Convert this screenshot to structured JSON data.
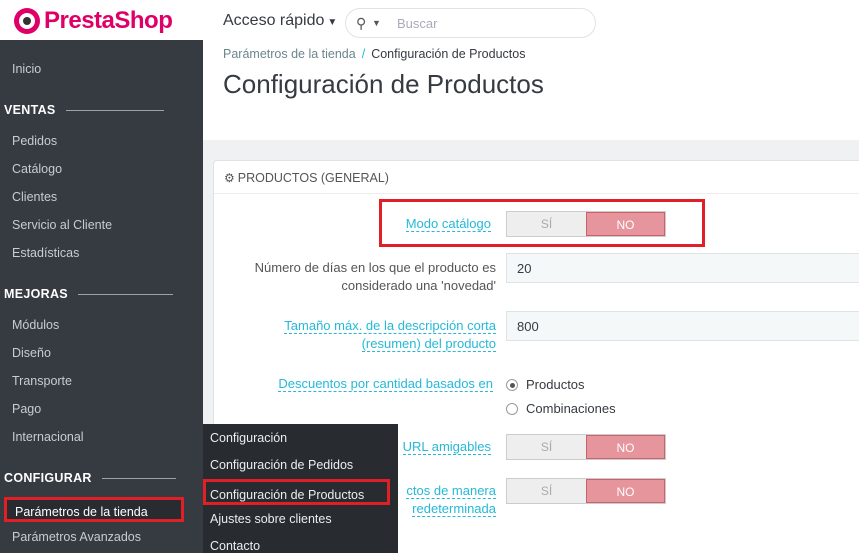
{
  "header": {
    "logo_text_1": "Presta",
    "logo_text_2": "Shop",
    "quick_access": "Acceso rápido",
    "search_placeholder": "Buscar"
  },
  "sidebar": {
    "home": "Inicio",
    "sections": [
      {
        "title": "VENTAS",
        "items": [
          "Pedidos",
          "Catálogo",
          "Clientes",
          "Servicio al Cliente",
          "Estadísticas"
        ]
      },
      {
        "title": "MEJORAS",
        "items": [
          "Módulos",
          "Diseño",
          "Transporte",
          "Pago",
          "Internacional"
        ]
      },
      {
        "title": "CONFIGURAR",
        "items": [
          "Parámetros de la tienda",
          "Parámetros Avanzados"
        ]
      }
    ]
  },
  "flyout": {
    "items": [
      "Configuración",
      "Configuración de Pedidos",
      "Configuración de Productos",
      "Ajustes sobre clientes",
      "Contacto"
    ],
    "active_index": 2
  },
  "breadcrumb": {
    "parent": "Parámetros de la tienda",
    "separator": "/",
    "current": "Configuración de Productos"
  },
  "page_title": "Configuración de Productos",
  "panel": {
    "title": "PRODUCTOS (GENERAL)",
    "fields": {
      "catalog_mode": {
        "label": "Modo catálogo",
        "yes": "SÍ",
        "no": "NO",
        "value": "NO"
      },
      "new_days": {
        "label_1": "Número de días en los que el producto es",
        "label_2": "considerado una 'novedad'",
        "value": "20"
      },
      "short_desc": {
        "label_1": "Tamaño máx. de la descripción corta",
        "label_2": "(resumen) del producto",
        "value": "800"
      },
      "discounts": {
        "label": "Descuentos por cantidad basados en",
        "options": [
          "Productos",
          "Combinaciones"
        ],
        "selected": "Productos"
      },
      "friendly_url": {
        "label": "URL amigables",
        "yes": "SÍ",
        "no": "NO",
        "value": "NO"
      },
      "default_attr": {
        "label_1": "ctos de manera",
        "label_2": "redeterminada",
        "yes": "SÍ",
        "no": "NO",
        "value": "NO"
      }
    }
  },
  "colors": {
    "accent": "#25b9d7",
    "brand": "#df0067",
    "highlight": "#e11f26",
    "no_active": "#e6959c",
    "sidebar_bg": "#363a41"
  }
}
